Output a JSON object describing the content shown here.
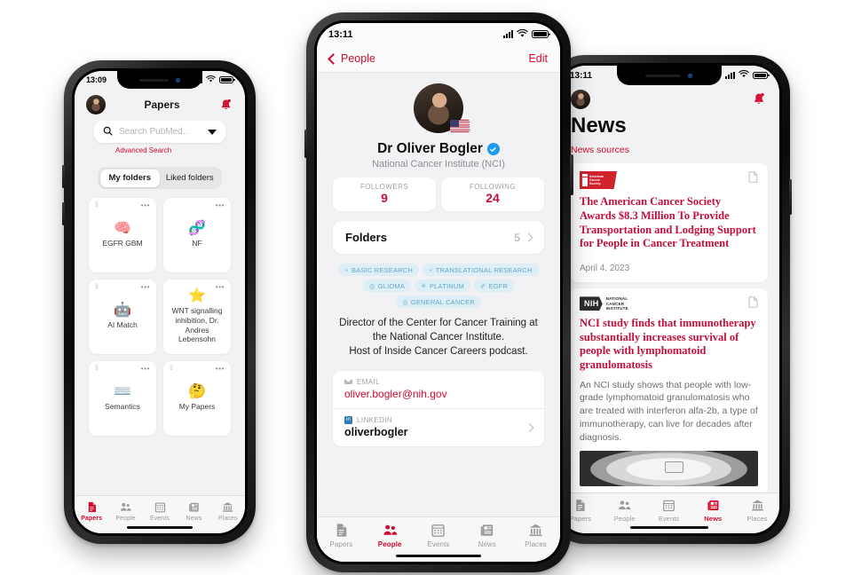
{
  "app": {
    "brand_red": "#cf0a2c",
    "accent_blue": "#1d9bf0",
    "pill_bg": "#ddeef6",
    "pill_fg": "#63a8c4"
  },
  "tabs": [
    {
      "label": "Papers",
      "icon": "document-icon"
    },
    {
      "label": "People",
      "icon": "people-icon"
    },
    {
      "label": "Events",
      "icon": "calendar-icon"
    },
    {
      "label": "News",
      "icon": "newspaper-icon"
    },
    {
      "label": "Places",
      "icon": "bank-icon"
    }
  ],
  "left_phone": {
    "status": {
      "time": "13:09"
    },
    "header": {
      "title": "Papers",
      "avatar": "user-avatar",
      "bell": "notification-bell-icon"
    },
    "search": {
      "placeholder": "Search PubMed..",
      "icon": "search-icon",
      "dropdown": "chevron-down-icon"
    },
    "advanced_search": "Advanced Search",
    "segments": [
      {
        "label": "My folders",
        "selected": true
      },
      {
        "label": "Liked folders",
        "selected": false
      }
    ],
    "folders": [
      {
        "name": "EGFR GBM",
        "emoji": "🧠"
      },
      {
        "name": "NF",
        "emoji": "🧬"
      },
      {
        "name": "AI Match",
        "emoji": "🤖"
      },
      {
        "name": "WNT signalling inhibition, Dr. Andres Lebensohn",
        "emoji": "⭐"
      },
      {
        "name": "Semantics",
        "emoji": "⌨️"
      },
      {
        "name": "My Papers",
        "emoji": "🤔"
      }
    ],
    "active_tab": "Papers"
  },
  "center_phone": {
    "status": {
      "time": "13:11"
    },
    "nav": {
      "back_label": "People",
      "back_icon": "chevron-left-icon",
      "edit_label": "Edit"
    },
    "profile": {
      "name": "Dr Oliver Bogler",
      "verified": true,
      "organization": "National Cancer Institute (NCI)",
      "flag": "us-flag"
    },
    "stats": [
      {
        "label": "FOLLOWERS",
        "value": "9"
      },
      {
        "label": "FOLLOWING",
        "value": "24"
      }
    ],
    "folders_row": {
      "label": "Folders",
      "count": "5",
      "chevron": "chevron-right-icon"
    },
    "tags": [
      {
        "label": "BASIC RESEARCH",
        "icon": "⑂"
      },
      {
        "label": "TRANSLATIONAL RESEARCH",
        "icon": "⑂"
      },
      {
        "label": "GLIOMA",
        "icon": "◎"
      },
      {
        "label": "PLATINUM",
        "icon": "⚘"
      },
      {
        "label": "EGFR",
        "icon": "✐"
      },
      {
        "label": "GENERAL CANCER",
        "icon": "◎"
      }
    ],
    "bio": "Director of the Center for Cancer Training at the National Cancer Institute.\nHost of Inside Cancer Careers podcast.",
    "contacts": [
      {
        "label": "EMAIL",
        "value": "oliver.bogler@nih.gov",
        "icon": "envelope-icon",
        "style": "red"
      },
      {
        "label": "LINKEDIN",
        "value": "oliverbogler",
        "icon": "linkedin-icon",
        "style": "dark"
      }
    ],
    "active_tab": "People"
  },
  "right_phone": {
    "status": {
      "time": "13:11"
    },
    "header": {
      "avatar": "user-avatar",
      "bell": "notification-bell-icon"
    },
    "title": "News",
    "sources_link": "News sources",
    "articles": [
      {
        "source": "American Cancer Society",
        "source_logo": "acs-logo",
        "headline": "The American Cancer Society Awards $8.3 Million To Provide Transportation and Lodging Support for People in Cancer Treatment",
        "summary": "",
        "date": "April 4, 2023",
        "doc_icon": "document-icon"
      },
      {
        "source": "NIH National Cancer Institute",
        "source_logo": "nih-logo",
        "source_mark": "NIH",
        "source_sub": "NATIONAL\nCANCER\nINSTITUTE",
        "headline": "NCI study finds that immunotherapy substantially increases survival of people with lymphomatoid granulomatosis",
        "summary": "An NCI study shows that people with low-grade lymphomatoid granulomatosis who are treated with interferon alfa-2b, a type of immunotherapy, can live for decades after diagnosis.",
        "date": "",
        "doc_icon": "document-icon",
        "thumbnail": "ct-scan-image"
      }
    ],
    "active_tab": "News"
  }
}
